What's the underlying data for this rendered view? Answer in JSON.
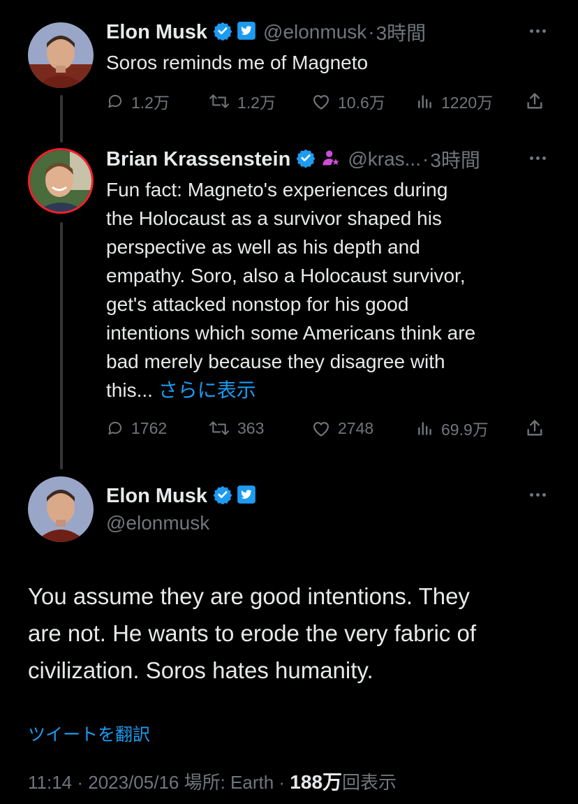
{
  "tweet1": {
    "name": "Elon Musk",
    "handle": "@elonmusk",
    "separator": "·",
    "time": "3時間",
    "text": "Soros reminds me of Magneto",
    "replies": "1.2万",
    "retweets": "1.2万",
    "likes": "10.6万",
    "views": "1220万"
  },
  "tweet2": {
    "name": "Brian Krassenstein",
    "handle": "@kras...",
    "separator": "·",
    "time": "3時間",
    "text_lines": [
      "Fun fact:  Magneto's experiences during",
      "the Holocaust as a survivor shaped his",
      "perspective as well as his depth and",
      "empathy.  Soro, also a Holocaust survivor,",
      "get's attacked nonstop for his good",
      "intentions which some Americans think are",
      "bad merely because they disagree with",
      "this..."
    ],
    "show_more": "さらに表示",
    "replies": "1762",
    "retweets": "363",
    "likes": "2748",
    "views": "69.9万"
  },
  "tweet3": {
    "name": "Elon Musk",
    "handle": "@elonmusk",
    "text_lines": [
      "You assume they are good intentions. They",
      "are not. He wants to erode the very fabric of",
      "civilization. Soros hates humanity."
    ],
    "translate": "ツイートを翻訳",
    "meta_prefix": "11:14 · 2023/05/16 場所: Earth · ",
    "views_count": "188万",
    "views_suffix": "回表示"
  },
  "icons": {
    "verified": "verified-badge-icon",
    "twitter": "twitter-affiliate-icon",
    "affiliate": "affiliate-person-icon",
    "reply": "reply-icon",
    "retweet": "retweet-icon",
    "like": "heart-icon",
    "views": "views-icon",
    "share": "share-icon",
    "more": "more-icon"
  },
  "colors": {
    "background": "#000000",
    "text": "#e7e9ea",
    "muted": "#71767b",
    "link": "#1d9bf0",
    "affiliate": "#c94fd6",
    "avatar_ring": "#f4212e"
  }
}
